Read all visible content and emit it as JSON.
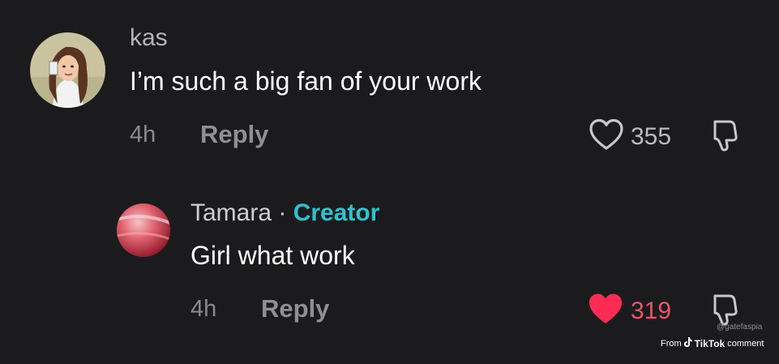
{
  "comments": [
    {
      "username": "kas",
      "text": "I’m such a big fan of your work",
      "time": "4h",
      "reply_label": "Reply",
      "likes": "355",
      "liked": false
    },
    {
      "username": "Tamara",
      "separator": " · ",
      "badge": "Creator",
      "text": "Girl what work",
      "time": "4h",
      "reply_label": "Reply",
      "likes": "319",
      "liked": true
    }
  ],
  "watermark": {
    "handle": "@gatefaspia",
    "from": "From",
    "brand": "TikTok",
    "suffix": "comment"
  },
  "colors": {
    "background": "#1b1b1d",
    "creator_accent": "#2fc2cf",
    "liked_heart": "#fe2c55"
  }
}
